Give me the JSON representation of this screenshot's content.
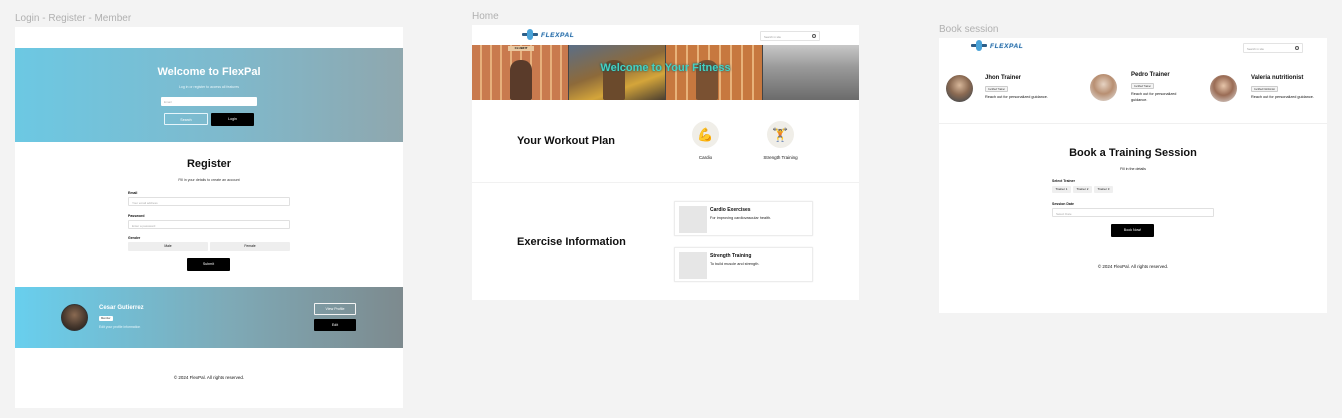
{
  "frames": {
    "login": {
      "label": "Login - Register - Member",
      "hero": {
        "title": "Welcome to FlexPal",
        "subtitle": "Log in or register to access all features",
        "email_placeholder": "Email",
        "search_label": "Search",
        "login_label": "Login"
      },
      "register": {
        "title": "Register",
        "subtitle": "Fill in your details to create an account",
        "email_label": "Email",
        "email_placeholder": "Your email address",
        "password_label": "Password",
        "password_placeholder": "Enter a password",
        "gender_label": "Gender",
        "male_label": "Male",
        "female_label": "Female",
        "submit_label": "Submit"
      },
      "member": {
        "name": "Cesar Gutierrez",
        "badge": "Member",
        "edit_text": "Edit your profile information",
        "view_profile_label": "View Profile",
        "edit_label": "Edit"
      },
      "footer": "© 2024 FlexPal. All rights reserved."
    },
    "home": {
      "label": "Home",
      "brand": "FLEXPAL",
      "search_placeholder": "Search in site",
      "banner_title": "Welcome to Your Fitness",
      "banner_sign": "CLUBFIT",
      "workout_title": "Your Workout Plan",
      "categories": [
        {
          "icon": "💪",
          "label": "Cardio"
        },
        {
          "icon": "🏋️",
          "label": "Strength Training"
        }
      ],
      "exercise_title": "Exercise Information",
      "exercises": [
        {
          "title": "Cardio Exercises",
          "desc": "For improving cardiovascular health."
        },
        {
          "title": "Strength Training",
          "desc": "To build muscle and strength."
        }
      ]
    },
    "book": {
      "label": "Book session",
      "brand": "FLEXPAL",
      "search_placeholder": "Search in site",
      "trainers": [
        {
          "name": "Jhon Trainer",
          "badge": "Certified Trainer",
          "desc": "Reach out for personalized guidance."
        },
        {
          "name": "Pedro Trainer",
          "badge": "Certified Trainer",
          "desc": "Reach out for personalized guidance."
        },
        {
          "name": "Valeria  nutritionist",
          "badge": "Certified Nutritionist",
          "desc": "Reach out for personalized guidance."
        }
      ],
      "title": "Book a Training Session",
      "subtitle": "Fill in the details",
      "select_label": "Select Trainer",
      "trainer_options": [
        "Trainer 1",
        "Trainer 2",
        "Trainer 3"
      ],
      "date_label": "Session Date",
      "date_placeholder": "Select Date",
      "book_label": "Book Now!",
      "footer": "© 2024 FlexPal. All rights reserved."
    }
  }
}
